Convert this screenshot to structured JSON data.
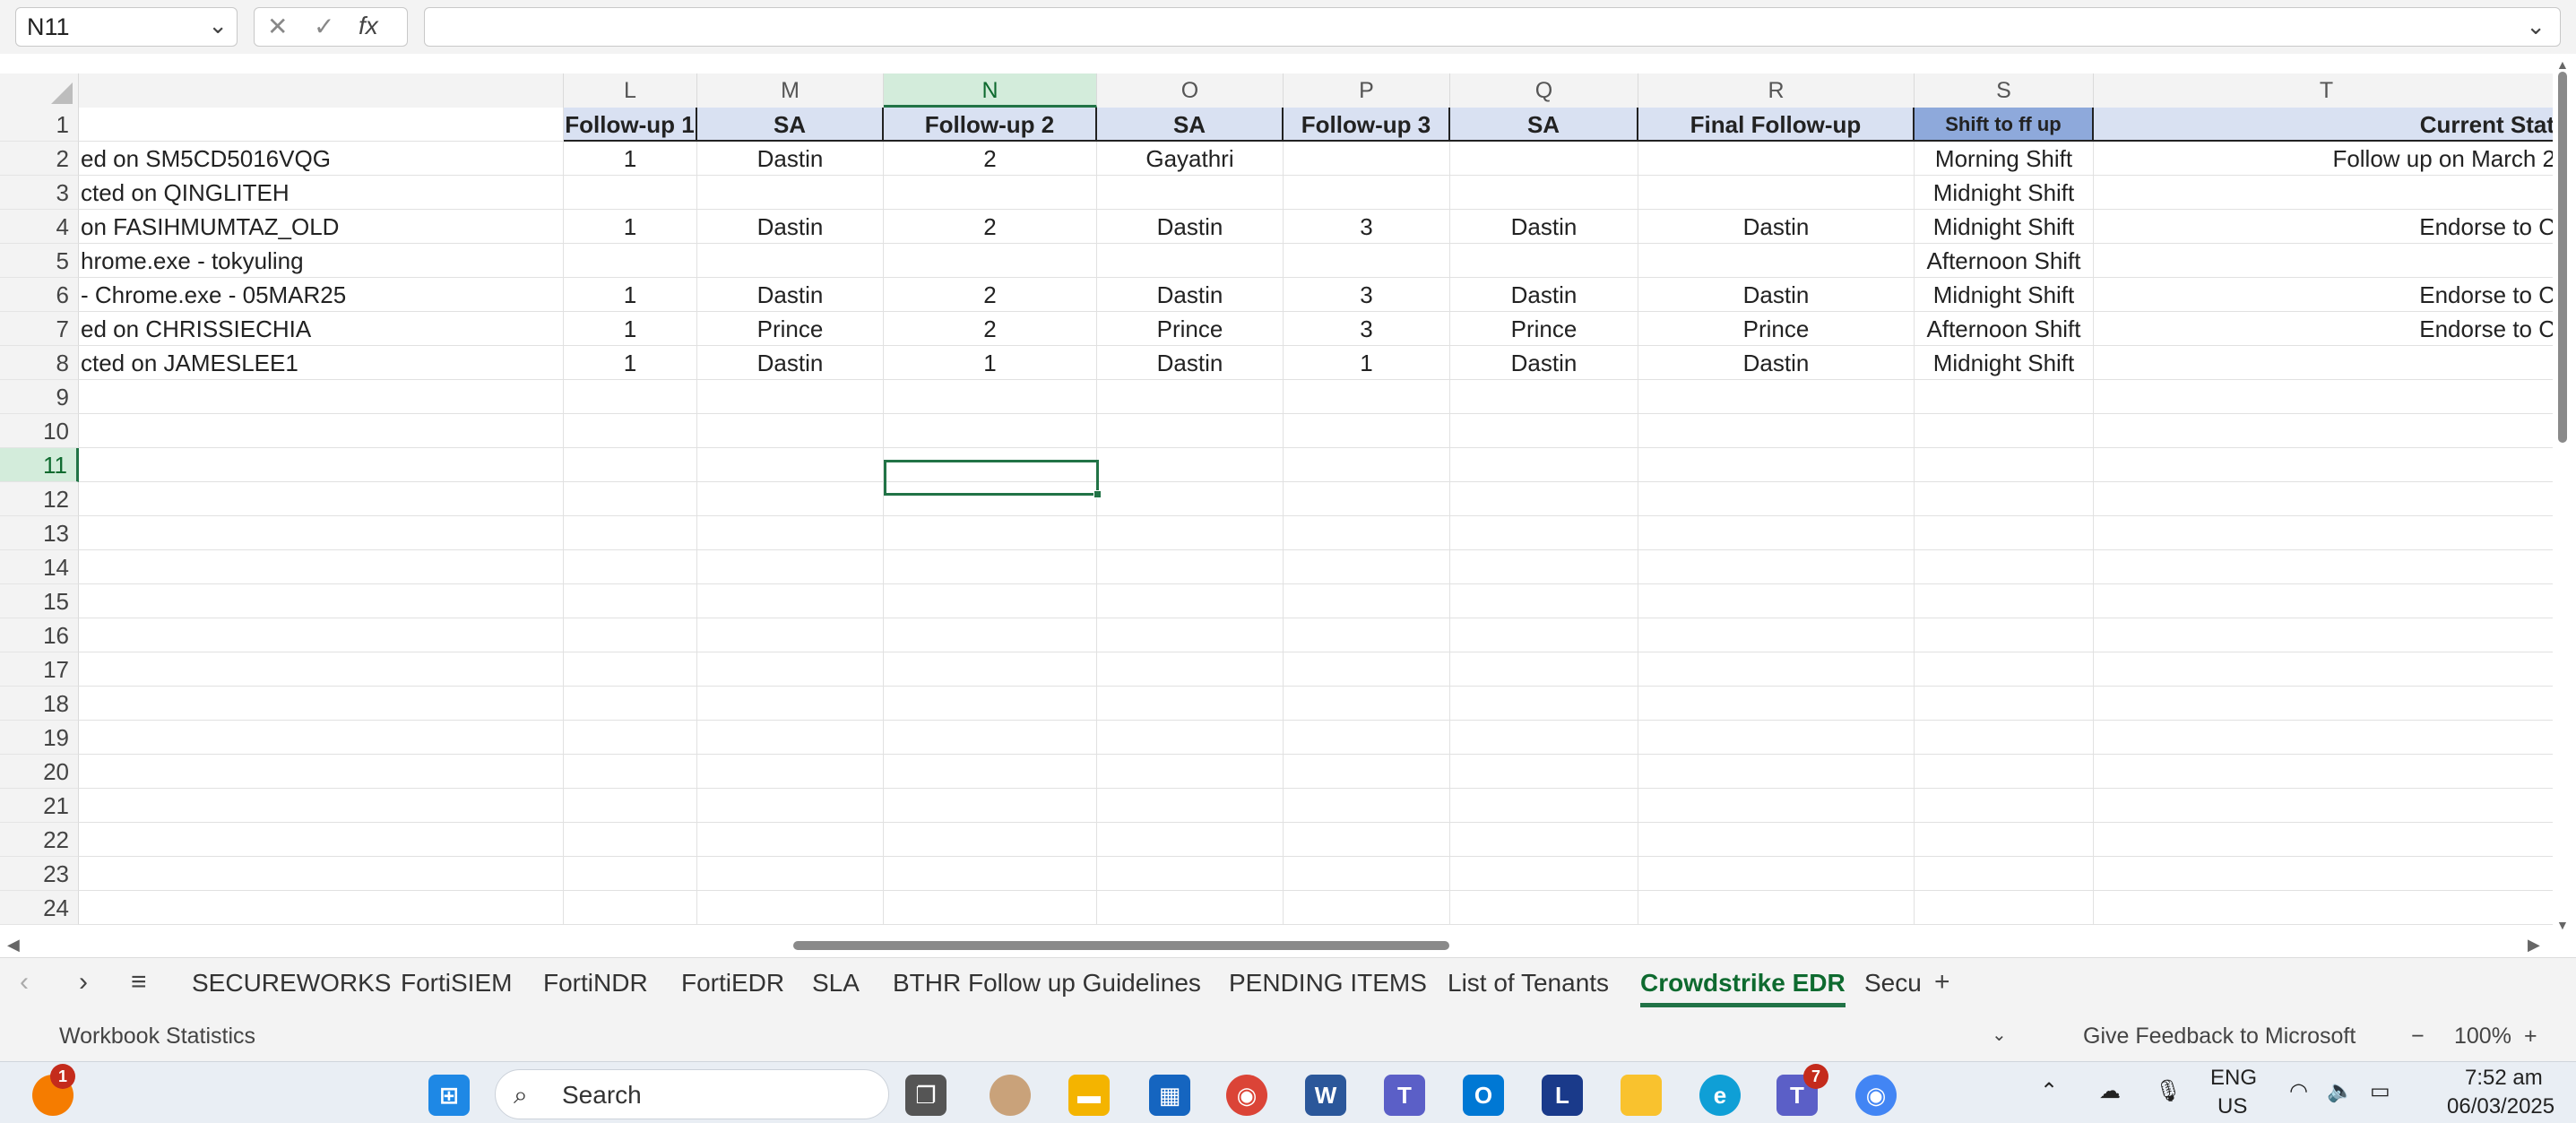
{
  "formula_bar": {
    "name_box": "N11",
    "formula_value": "",
    "fx_label": "fx"
  },
  "columns": [
    {
      "label": "",
      "key": "K"
    },
    {
      "label": "L"
    },
    {
      "label": "M"
    },
    {
      "label": "N",
      "selected": true
    },
    {
      "label": "O"
    },
    {
      "label": "P"
    },
    {
      "label": "Q"
    },
    {
      "label": "R"
    },
    {
      "label": "S"
    },
    {
      "label": "T"
    }
  ],
  "header_row": [
    "",
    "Follow-up 1",
    "SA",
    "Follow-up 2",
    "SA",
    "Follow-up 3",
    "SA",
    "Final Follow-up",
    "Shift to ff up",
    "Current Stat"
  ],
  "rows": [
    {
      "num": "2",
      "cells": [
        "ed on SM5CD5016VQG",
        "1",
        "Dastin",
        "2",
        "Gayathri",
        "",
        "",
        "",
        "Morning Shift",
        "Follow up on March 2"
      ]
    },
    {
      "num": "3",
      "cells": [
        "cted on QINGLITEH",
        "",
        "",
        "",
        "",
        "",
        "",
        "",
        "Midnight Shift",
        ""
      ]
    },
    {
      "num": "4",
      "cells": [
        "on FASIHMUMTAZ_OLD",
        "1",
        "Dastin",
        "2",
        "Dastin",
        "3",
        "Dastin",
        "Dastin",
        "Midnight Shift",
        "Endorse to C"
      ]
    },
    {
      "num": "5",
      "cells": [
        "hrome.exe - tokyuling",
        "",
        "",
        "",
        "",
        "",
        "",
        "",
        "Afternoon Shift",
        ""
      ]
    },
    {
      "num": "6",
      "cells": [
        "- Chrome.exe - 05MAR25",
        "1",
        "Dastin",
        "2",
        "Dastin",
        "3",
        "Dastin",
        "Dastin",
        "Midnight Shift",
        "Endorse to C"
      ]
    },
    {
      "num": "7",
      "cells": [
        "ed on CHRISSIECHIA",
        "1",
        "Prince",
        "2",
        "Prince",
        "3",
        "Prince",
        "Prince",
        "Afternoon Shift",
        "Endorse to C"
      ]
    },
    {
      "num": "8",
      "cells": [
        "cted on JAMESLEE1",
        "1",
        "Dastin",
        "1",
        "Dastin",
        "1",
        "Dastin",
        "Dastin",
        "Midnight Shift",
        ""
      ]
    },
    {
      "num": "9",
      "cells": [
        "",
        "",
        "",
        "",
        "",
        "",
        "",
        "",
        "",
        ""
      ]
    },
    {
      "num": "10",
      "cells": [
        "",
        "",
        "",
        "",
        "",
        "",
        "",
        "",
        "",
        ""
      ]
    },
    {
      "num": "11",
      "cells": [
        "",
        "",
        "",
        "",
        "",
        "",
        "",
        "",
        "",
        ""
      ],
      "selected": true
    },
    {
      "num": "12",
      "cells": [
        "",
        "",
        "",
        "",
        "",
        "",
        "",
        "",
        "",
        ""
      ]
    },
    {
      "num": "13",
      "cells": [
        "",
        "",
        "",
        "",
        "",
        "",
        "",
        "",
        "",
        ""
      ]
    },
    {
      "num": "14",
      "cells": [
        "",
        "",
        "",
        "",
        "",
        "",
        "",
        "",
        "",
        ""
      ]
    },
    {
      "num": "15",
      "cells": [
        "",
        "",
        "",
        "",
        "",
        "",
        "",
        "",
        "",
        ""
      ]
    },
    {
      "num": "16",
      "cells": [
        "",
        "",
        "",
        "",
        "",
        "",
        "",
        "",
        "",
        ""
      ]
    },
    {
      "num": "17",
      "cells": [
        "",
        "",
        "",
        "",
        "",
        "",
        "",
        "",
        "",
        ""
      ]
    },
    {
      "num": "18",
      "cells": [
        "",
        "",
        "",
        "",
        "",
        "",
        "",
        "",
        "",
        ""
      ]
    },
    {
      "num": "19",
      "cells": [
        "",
        "",
        "",
        "",
        "",
        "",
        "",
        "",
        "",
        ""
      ]
    },
    {
      "num": "20",
      "cells": [
        "",
        "",
        "",
        "",
        "",
        "",
        "",
        "",
        "",
        ""
      ]
    },
    {
      "num": "21",
      "cells": [
        "",
        "",
        "",
        "",
        "",
        "",
        "",
        "",
        "",
        ""
      ]
    },
    {
      "num": "22",
      "cells": [
        "",
        "",
        "",
        "",
        "",
        "",
        "",
        "",
        "",
        ""
      ]
    },
    {
      "num": "23",
      "cells": [
        "",
        "",
        "",
        "",
        "",
        "",
        "",
        "",
        "",
        ""
      ]
    },
    {
      "num": "24",
      "cells": [
        "",
        "",
        "",
        "",
        "",
        "",
        "",
        "",
        "",
        ""
      ]
    }
  ],
  "sheet_tabs": [
    {
      "label": "SECUREWORKS"
    },
    {
      "label": "FortiSIEM"
    },
    {
      "label": "FortiNDR"
    },
    {
      "label": "FortiEDR"
    },
    {
      "label": "SLA"
    },
    {
      "label": "BTHR Follow up Guidelines"
    },
    {
      "label": "PENDING ITEMS"
    },
    {
      "label": "List of Tenants"
    },
    {
      "label": "Crowdstrike EDR",
      "active": true
    },
    {
      "label": "Secu"
    }
  ],
  "status_bar": {
    "workbook_stats": "Workbook Statistics",
    "feedback": "Give Feedback to Microsoft",
    "zoom": "100%"
  },
  "taskbar": {
    "search_placeholder": "Search",
    "notification_badge": "1",
    "teams_badge": "7",
    "language": "ENG",
    "region": "US",
    "time": "7:52 am",
    "date": "06/03/2025"
  },
  "colors": {
    "accent": "#217346",
    "header_fill": "#d9e1f2",
    "shift_header_fill": "#8ea9db"
  }
}
